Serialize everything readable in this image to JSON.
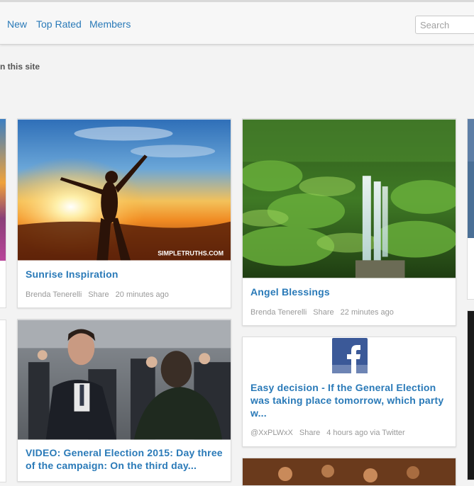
{
  "nav": {
    "items": [
      "New",
      "Top Rated",
      "Members"
    ],
    "search_placeholder": "Search"
  },
  "subtitle": "n this site",
  "cards": [
    {
      "title": "Sunrise Inspiration",
      "image_caption": "SIMPLETRUTHS.COM",
      "author": "Brenda Tenerelli",
      "share": "Share",
      "time": "20 minutes ago"
    },
    {
      "title": "Angel Blessings",
      "author": "Brenda Tenerelli",
      "share": "Share",
      "time": "22 minutes ago"
    },
    {
      "title": "Easy decision - If the General Election was taking place tomorrow, which party w...",
      "author": "@XxPLWxX",
      "share": "Share",
      "time": "4 hours ago via Twitter",
      "icon": "facebook-icon"
    },
    {
      "title": "VIDEO: General Election 2015: Day three of the campaign: On the third day..."
    }
  ]
}
